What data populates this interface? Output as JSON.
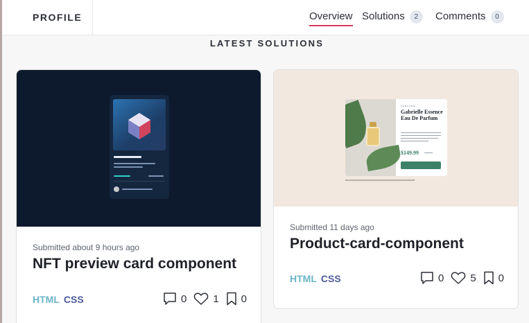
{
  "header": {
    "profile_label": "PROFILE",
    "tabs": [
      {
        "label": "Overview",
        "active": true
      },
      {
        "label": "Solutions",
        "badge": "2"
      },
      {
        "label": "Comments",
        "badge": "0"
      }
    ]
  },
  "section": {
    "title": "LATEST SOLUTIONS"
  },
  "solutions": [
    {
      "submitted": "Submitted about 9 hours ago",
      "title": "NFT preview card component",
      "tags": [
        "HTML",
        "CSS"
      ],
      "comments": "0",
      "likes": "1",
      "bookmarks": "0"
    },
    {
      "submitted": "Submitted 11 days ago",
      "title": "Product-card-component",
      "tags": [
        "HTML",
        "CSS"
      ],
      "comments": "0",
      "likes": "5",
      "bookmarks": "0"
    }
  ],
  "thumbnails": {
    "product": {
      "kicker": "PERFUME",
      "name": "Gabrielle Essence Eau De Parfum",
      "price": "$149.99"
    }
  },
  "colors": {
    "accent": "#d43b5c",
    "html_tag": "#6ab4c8",
    "css_tag": "#4c5a9c",
    "product_green": "#3d8168"
  }
}
